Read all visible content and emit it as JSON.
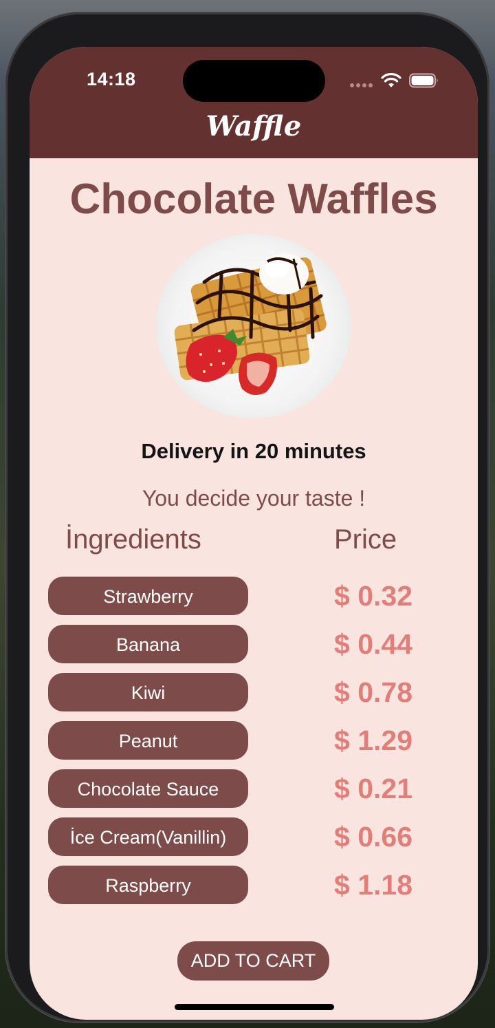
{
  "status_bar": {
    "time": "14:18"
  },
  "header": {
    "title": "Waffle"
  },
  "main": {
    "title": "Chocolate Waffles",
    "delivery_text": "Delivery in 20 minutes",
    "tagline": "You decide your taste !",
    "columns": {
      "ingredients": "İngredients",
      "price": "Price"
    },
    "items": [
      {
        "name": "Strawberry",
        "price": "$ 0.32"
      },
      {
        "name": "Banana",
        "price": "$ 0.44"
      },
      {
        "name": "Kiwi",
        "price": "$ 0.78"
      },
      {
        "name": "Peanut",
        "price": "$ 1.29"
      },
      {
        "name": "Chocolate Sauce",
        "price": "$ 0.21"
      },
      {
        "name": "İce Cream(Vanillin)",
        "price": "$ 0.66"
      },
      {
        "name": "Raspberry",
        "price": "$ 1.18"
      }
    ],
    "cart_button": "ADD TO CART"
  },
  "colors": {
    "header_bg": "#633230",
    "screen_bg": "#f9e4e0",
    "accent_brown": "#7d4b4a",
    "price_pink": "#e07f7a"
  },
  "icons": {
    "wifi": "wifi-icon",
    "battery": "battery-icon",
    "signal": "cellular-signal-icon"
  }
}
